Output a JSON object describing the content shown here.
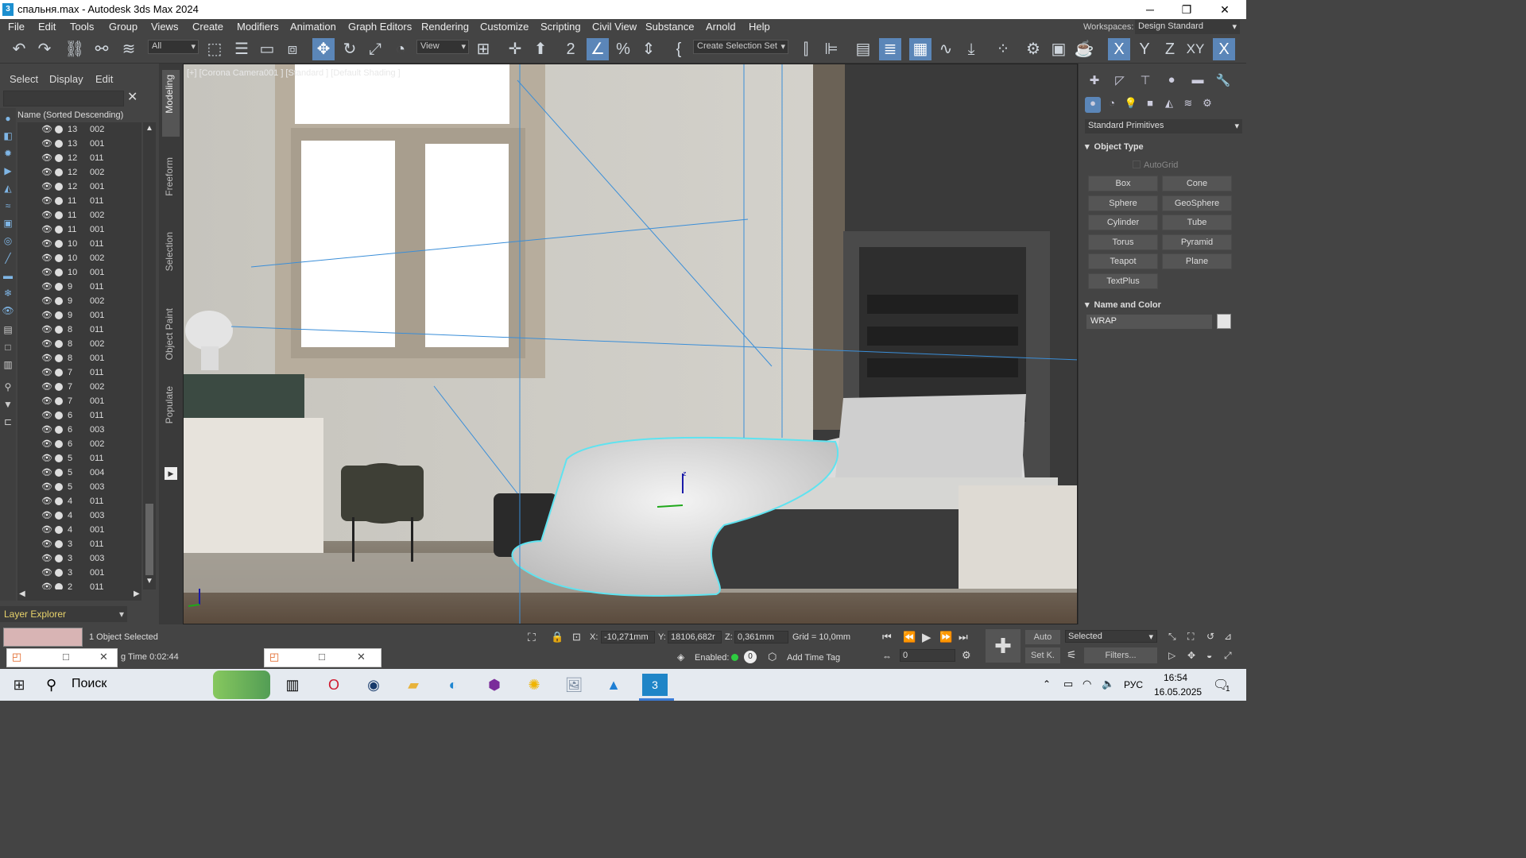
{
  "window": {
    "title": "спальня.max - Autodesk 3ds Max 2024",
    "app_icon": "3",
    "minimize": "─",
    "maximize": "❐",
    "close": "✕"
  },
  "menu": [
    "File",
    "Edit",
    "Tools",
    "Group",
    "Views",
    "Create",
    "Modifiers",
    "Animation",
    "Graph Editors",
    "Rendering",
    "Customize",
    "Scripting",
    "Civil View",
    "Substance",
    "Arnold",
    "Help"
  ],
  "workspace": {
    "label": "Workspaces:",
    "value": "Design Standard"
  },
  "toolbar": {
    "filter_value": "All",
    "ref_coord": "View",
    "selection_set": "Create Selection Set",
    "axis_x": "X",
    "axis_y": "Y",
    "axis_z": "Z",
    "axis_xy": "XY"
  },
  "scene_explorer": {
    "tabs": [
      "Select",
      "Display",
      "Edit"
    ],
    "column_header": "Name (Sorted Descending)",
    "rows": [
      [
        "13",
        "002"
      ],
      [
        "13",
        "001"
      ],
      [
        "12",
        "011"
      ],
      [
        "12",
        "002"
      ],
      [
        "12",
        "001"
      ],
      [
        "11",
        "011"
      ],
      [
        "11",
        "002"
      ],
      [
        "11",
        "001"
      ],
      [
        "10",
        "011"
      ],
      [
        "10",
        "002"
      ],
      [
        "10",
        "001"
      ],
      [
        "9",
        "011"
      ],
      [
        "9",
        "002"
      ],
      [
        "9",
        "001"
      ],
      [
        "8",
        "011"
      ],
      [
        "8",
        "002"
      ],
      [
        "8",
        "001"
      ],
      [
        "7",
        "011"
      ],
      [
        "7",
        "002"
      ],
      [
        "7",
        "001"
      ],
      [
        "6",
        "011"
      ],
      [
        "6",
        "003"
      ],
      [
        "6",
        "002"
      ],
      [
        "5",
        "011"
      ],
      [
        "5",
        "004"
      ],
      [
        "5",
        "003"
      ],
      [
        "4",
        "011"
      ],
      [
        "4",
        "003"
      ],
      [
        "4",
        "001"
      ],
      [
        "3",
        "011"
      ],
      [
        "3",
        "003"
      ],
      [
        "3",
        "001"
      ],
      [
        "2",
        "011"
      ]
    ],
    "footer": "Layer Explorer"
  },
  "ribbon_tabs": [
    "Modeling",
    "Freeform",
    "Selection",
    "Object Paint",
    "Populate"
  ],
  "viewport": {
    "label": "[+] [Corona Camera001 ] [Standard ] [Default Shading ]"
  },
  "command_panel": {
    "category": "Standard Primitives",
    "object_type_header": "Object Type",
    "autogrid": "AutoGrid",
    "primitives": [
      "Box",
      "Cone",
      "Sphere",
      "GeoSphere",
      "Cylinder",
      "Tube",
      "Torus",
      "Pyramid",
      "Teapot",
      "Plane",
      "TextPlus"
    ],
    "name_color_header": "Name and Color",
    "object_name": "WRAP",
    "object_color": "#e5e5e5"
  },
  "status": {
    "selected": "1 Object Selected",
    "time_label": "g Time  0:02:44",
    "x_label": "X:",
    "x_value": "-10,271mm",
    "y_label": "Y:",
    "y_value": "18106,682r",
    "z_label": "Z:",
    "z_value": "0,361mm",
    "grid": "Grid = 10,0mm",
    "enabled": "Enabled:",
    "enabled_count": "0",
    "add_time_tag": "Add Time Tag",
    "auto": "Auto",
    "key_mode": "Selected",
    "setk": "Set K.",
    "filters": "Filters...",
    "frame": "0"
  },
  "taskbar": {
    "search": "Поиск",
    "lang": "РУС",
    "time": "16:54",
    "date": "16.05.2025",
    "notif": "1"
  },
  "colors": {
    "accent": "#5b86b8",
    "selection_outline": "#5fe3f0",
    "layer_explorer": "#e8d36b"
  }
}
